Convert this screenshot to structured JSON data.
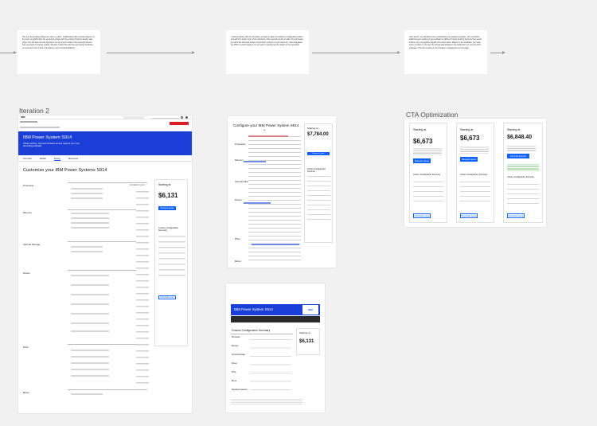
{
  "notes": [
    "The new the working design we came up with. I collaborated with a visual designer on the team to rapidly align the emerging design with the existing Systems design style guide. The SA was not sold anywhere, but we tried to make it the concepts that we was emerging at least as usable. We also created the with the ugly design iterations we expected a the 3 and v2 anywhere, but to broad limitations.",
    "I worked closely with the developer to begin to align the backend configuration builder tool with the design style of the storefront. After several rounds of edits, the tool began to match the intended design and function properly on the back-end. I also delegated the PDF to a print designer on our team to quickly get the design to the developer.",
    "After launch, we identified some optimizations we wanted to explore. We conducted additional user testing to get feedback on different button wording and how they would improve the comparative payoffs from each action. Based on the feedback, we made some revisions to the way the pricing was displayed, the backorder text, and the CTA language. This has resulted in an increase in engagement on the page."
  ],
  "iteration": {
    "section_title": "Iteration 2",
    "brand": "IBM",
    "tabs": [
      "Overview",
      "Details",
      "Pricing",
      "Resources"
    ],
    "hero_title": "IBM Power System S914",
    "hero_sub": "Virtual machines, cloud and container services ready for your most demanding workloads",
    "heading": "Customize your IBM Power Systems S914",
    "starting_label": "Starting at",
    "starting_price": "$6,131",
    "cta": "Request quote",
    "summary_title": "Custom Configuration Summary",
    "secondary_btn": "Download quote",
    "groups": [
      "Processor",
      "Memory",
      "Internal Storage",
      "Drives",
      "PCIe",
      "Bezel"
    ],
    "included": "Included in price"
  },
  "markup": {
    "title": "Configure your IBM Power System S914",
    "starting_label": "Starting at",
    "price": "$7,784.00",
    "cta": "Request Quote",
    "summary": "Custom Configuration Summary",
    "groups": [
      "Processor",
      "Memory",
      "Internal Storage",
      "Drives",
      "PCIe",
      "Bezel"
    ]
  },
  "pdf": {
    "hero_title": "IBM Power System S914",
    "brand": "IBM",
    "summary": "Custom Configuration Summary",
    "starting_label": "Starting at",
    "price": "$6,131",
    "rows": [
      "Processor",
      "Memory",
      "Internal Storage",
      "Drives",
      "PCIe",
      "Bezel",
      "Standard Features"
    ]
  },
  "cta": {
    "section_title": "CTA Optimization",
    "cards": [
      {
        "label": "Starting at",
        "price": "$6,673",
        "cta": "Request quote",
        "summary": "Custom Configuration Summary",
        "secondary": "Download quote"
      },
      {
        "label": "Starting at",
        "price": "$6,673",
        "cta": "Request quote",
        "summary": "Custom Configuration Summary",
        "secondary": "Download quote"
      },
      {
        "label": "Starting at",
        "price": "$6,848.40",
        "cta": "Get a formal quote",
        "summary": "Custom Configuration Summary",
        "secondary": "Download quote"
      }
    ]
  }
}
